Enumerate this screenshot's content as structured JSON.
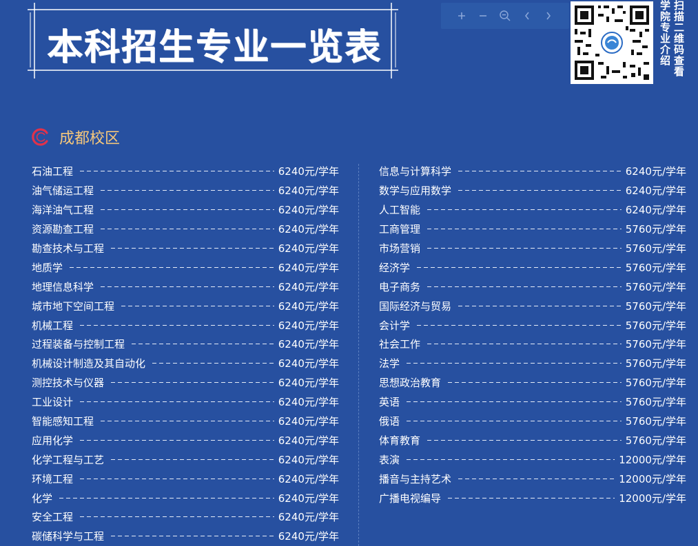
{
  "header": {
    "title": "本科招生专业一览表"
  },
  "toolbar": {
    "buttons": [
      "zoom-in",
      "zoom-out",
      "zoom-reset",
      "prev-page",
      "next-page"
    ]
  },
  "qr": {
    "caption_col1": "扫描二维码查看",
    "caption_col2": "学院专业介绍"
  },
  "section": {
    "title": "成都校区",
    "accent_color": "#e0324b"
  },
  "left_majors": [
    {
      "name": "石油工程",
      "fee": "6240元/学年"
    },
    {
      "name": "油气储运工程",
      "fee": "6240元/学年"
    },
    {
      "name": "海洋油气工程",
      "fee": "6240元/学年"
    },
    {
      "name": "资源勘查工程",
      "fee": "6240元/学年"
    },
    {
      "name": "勘查技术与工程",
      "fee": "6240元/学年"
    },
    {
      "name": "地质学",
      "fee": "6240元/学年"
    },
    {
      "name": "地理信息科学",
      "fee": "6240元/学年"
    },
    {
      "name": "城市地下空间工程",
      "fee": "6240元/学年"
    },
    {
      "name": "机械工程",
      "fee": "6240元/学年"
    },
    {
      "name": "过程装备与控制工程",
      "fee": "6240元/学年"
    },
    {
      "name": "机械设计制造及其自动化",
      "fee": "6240元/学年"
    },
    {
      "name": "测控技术与仪器",
      "fee": "6240元/学年"
    },
    {
      "name": "工业设计",
      "fee": "6240元/学年"
    },
    {
      "name": "智能感知工程",
      "fee": "6240元/学年"
    },
    {
      "name": "应用化学",
      "fee": "6240元/学年"
    },
    {
      "name": "化学工程与工艺",
      "fee": "6240元/学年"
    },
    {
      "name": "环境工程",
      "fee": "6240元/学年"
    },
    {
      "name": "化学",
      "fee": "6240元/学年"
    },
    {
      "name": "安全工程",
      "fee": "6240元/学年"
    },
    {
      "name": "碳储科学与工程",
      "fee": "6240元/学年"
    }
  ],
  "right_majors": [
    {
      "name": "信息与计算科学",
      "fee": "6240元/学年"
    },
    {
      "name": "数学与应用数学",
      "fee": "6240元/学年"
    },
    {
      "name": "人工智能",
      "fee": "6240元/学年"
    },
    {
      "name": "工商管理",
      "fee": "5760元/学年"
    },
    {
      "name": "市场营销",
      "fee": "5760元/学年"
    },
    {
      "name": "经济学",
      "fee": "5760元/学年"
    },
    {
      "name": "电子商务",
      "fee": "5760元/学年"
    },
    {
      "name": "国际经济与贸易",
      "fee": "5760元/学年"
    },
    {
      "name": "会计学",
      "fee": "5760元/学年"
    },
    {
      "name": "社会工作",
      "fee": "5760元/学年"
    },
    {
      "name": "法学",
      "fee": "5760元/学年"
    },
    {
      "name": "思想政治教育",
      "fee": "5760元/学年"
    },
    {
      "name": "英语",
      "fee": "5760元/学年"
    },
    {
      "name": "俄语",
      "fee": "5760元/学年"
    },
    {
      "name": "体育教育",
      "fee": "5760元/学年"
    },
    {
      "name": "表演",
      "fee": "12000元/学年"
    },
    {
      "name": "播音与主持艺术",
      "fee": "12000元/学年"
    },
    {
      "name": "广播电视编导",
      "fee": "12000元/学年"
    }
  ],
  "colors": {
    "background": "#2750a0",
    "section_title": "#f5c77b",
    "toolbar": "#2c5aa8"
  }
}
